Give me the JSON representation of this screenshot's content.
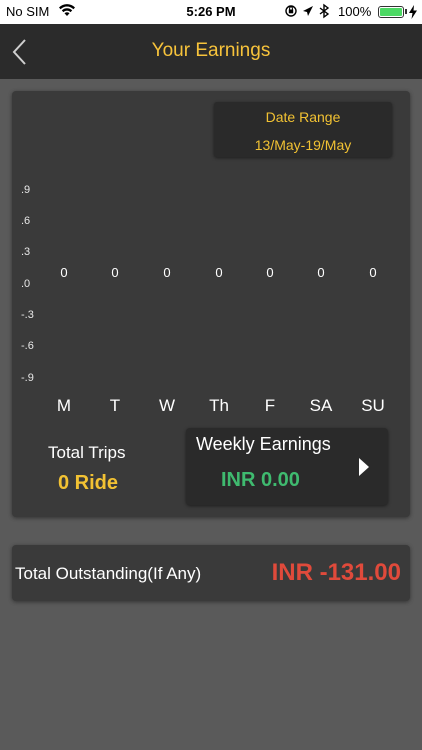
{
  "status_bar": {
    "carrier": "No SIM",
    "time": "5:26 PM",
    "battery": "100%",
    "icons": [
      "wifi-icon",
      "orientation-lock-icon",
      "location-arrow-icon",
      "bluetooth-icon",
      "battery-icon",
      "charging-bolt-icon"
    ]
  },
  "nav": {
    "title": "Your Earnings",
    "back_icon": "chevron-left-icon"
  },
  "date_range": {
    "label": "Date Range",
    "value": "13/May-19/May"
  },
  "chart_data": {
    "type": "bar",
    "categories": [
      "M",
      "T",
      "W",
      "Th",
      "F",
      "SA",
      "SU"
    ],
    "values": [
      0,
      0,
      0,
      0,
      0,
      0,
      0
    ],
    "data_labels": [
      "0",
      "0",
      "0",
      "0",
      "0",
      "0",
      "0"
    ],
    "y_tick_labels": [
      ".9",
      ".6",
      ".3",
      ".0",
      "-.3",
      "-.6",
      "-.9"
    ],
    "ylim": [
      -1,
      1
    ],
    "grid": false
  },
  "summary": {
    "total_trips_label": "Total Trips",
    "total_trips_value": "0 Ride",
    "weekly_earnings_label": "Weekly Earnings",
    "weekly_earnings_value": "INR 0.00",
    "weekly_arrow_icon": "play-arrow-icon"
  },
  "outstanding": {
    "label": "Total Outstanding(If Any)",
    "value": "INR -131.00"
  },
  "colors": {
    "accent": "#f7c33b",
    "positive": "#3fba6f",
    "negative": "#e04a3b",
    "background": "#5a5a5a",
    "card": "#3a3a3a",
    "nav": "#2b2b2b"
  }
}
